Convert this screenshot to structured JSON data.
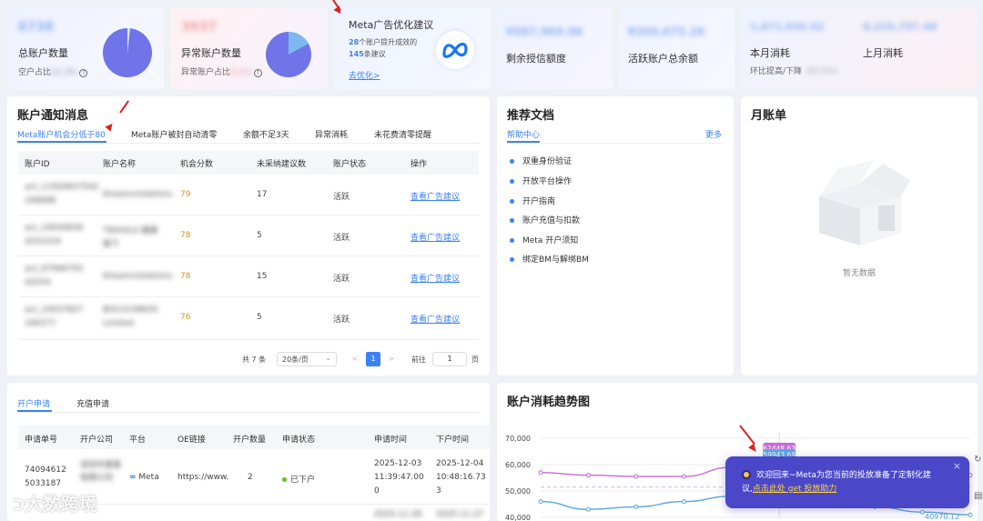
{
  "stats": {
    "total_accounts": {
      "value": "6738",
      "label": "总账户数量",
      "sub_label": "空户占比",
      "sub_value": "12.3%"
    },
    "abnormal_accounts": {
      "value": "3937",
      "label": "异常账户数量",
      "sub_label": "异常账户占比",
      "sub_value": "8.1%"
    },
    "meta_optimize": {
      "title": "Meta广告优化建议",
      "count_accounts": "28",
      "line1_suffix": "个账户提升成效的",
      "count_suggestions": "145",
      "line2_suffix": "条建议",
      "link": "去优化>"
    },
    "credit": {
      "value": "¥587,969.08",
      "label": "剩余授信额度"
    },
    "balance": {
      "value": "¥209,675.28",
      "label": "活跃账户总余额"
    },
    "spend": {
      "this_month_value": "1,871,036.92",
      "this_month_label": "本月消耗",
      "last_month_value": "6,225,797.48",
      "last_month_label": "上月消耗",
      "ratio_label": "环比提高/下降",
      "ratio_value": "-69.95%"
    }
  },
  "notifications": {
    "title": "账户通知消息",
    "tabs": [
      "Meta账户机会分低于80",
      "Meta账户被封自动清零",
      "余额不足3天",
      "异常消耗",
      "未花费清零提醒"
    ],
    "columns": [
      "账户ID",
      "账户名称",
      "机会分数",
      "未采纳建议数",
      "账户状态",
      "操作"
    ],
    "rows": [
      {
        "id1": "act_11929937542",
        "id2": "196688",
        "name": "Dreamvisitations",
        "score": "79",
        "pending": "17",
        "status": "活跃",
        "action": "查看广告建议"
      },
      {
        "id1": "act_19026836",
        "id2": "2031034",
        "name": "TIKHOLO 服装",
        "name2": "旗下",
        "score": "78",
        "pending": "5",
        "status": "活跃",
        "action": "查看广告建议"
      },
      {
        "id1": "act_67946755",
        "id2": "42034",
        "name": "Dreamvisitations",
        "score": "78",
        "pending": "15",
        "status": "活跃",
        "action": "查看广告建议"
      },
      {
        "id1": "act_10037827",
        "id2": "190377",
        "name": "BOCUCANIOS",
        "name2": "Limited",
        "score": "76",
        "pending": "5",
        "status": "活跃",
        "action": "查看广告建议"
      }
    ],
    "pagination": {
      "total": "共 7 条",
      "page_size": "20条/页",
      "prev": "<",
      "current": "1",
      "next": ">",
      "goto_label": "前往",
      "goto_value": "1",
      "page_unit": "页"
    }
  },
  "docs": {
    "title": "推荐文档",
    "tab": "帮助中心",
    "more": "更多",
    "items": [
      "双重身份验证",
      "开放平台操作",
      "开户指南",
      "账户充值与扣款",
      "Meta 开户须知",
      "绑定BM与解绑BM"
    ]
  },
  "monthly": {
    "title": "月账单",
    "empty": "暂无数据"
  },
  "applications": {
    "tabs": [
      "开户申请",
      "充值申请"
    ],
    "columns": [
      "申请单号",
      "开户公司",
      "平台",
      "OE链接",
      "开户数量",
      "申请状态",
      "申请时间",
      "下户时间"
    ],
    "rows": [
      {
        "id1": "74094612",
        "id2": "5033187",
        "company": "深圳市某某有限公司",
        "platform": "Meta",
        "oe": "https://www.",
        "count": "2",
        "status": "已下户",
        "apply1": "2025-12-03",
        "apply2": "11:39:47.00",
        "apply3": "0",
        "done1": "2025-12-04",
        "done2": "10:48:16.73",
        "done3": "3"
      }
    ],
    "partial_row": {
      "a": "2025-11-28",
      "b": "2025-11-27"
    }
  },
  "trend": {
    "title": "账户消耗趋势图",
    "y_ticks": [
      "70,000",
      "60,000",
      "50,000",
      "40,000"
    ],
    "markers": [
      "62448.63",
      "59943.69"
    ],
    "corner_value": "40970.12"
  },
  "chart_data": {
    "type": "line",
    "title": "账户消耗趋势图",
    "ylim": [
      40000,
      70000
    ],
    "series": [
      {
        "name": "",
        "values": [
          57000,
          56000,
          55500,
          55500,
          59000,
          62448.63,
          57000,
          56500,
          56000,
          56000
        ]
      },
      {
        "name": "",
        "values": [
          46000,
          43000,
          44000,
          46000,
          48000,
          59943.69,
          47000,
          44000,
          42000,
          40970.12
        ]
      }
    ],
    "colors": [
      "#c46cd9",
      "#5aa7e0"
    ]
  },
  "toast": {
    "text1": "欢迎回来~Meta为您当前的投放准备了定制化建",
    "text2": "议,",
    "link": "点击此处 get 投放助力",
    "close": "×"
  },
  "watermark": "大数跨境",
  "colors": {
    "accent": "#3b82f6",
    "pie": "#6f74e8",
    "toast_bg": "#4a47c9",
    "score": "#d9921f"
  }
}
